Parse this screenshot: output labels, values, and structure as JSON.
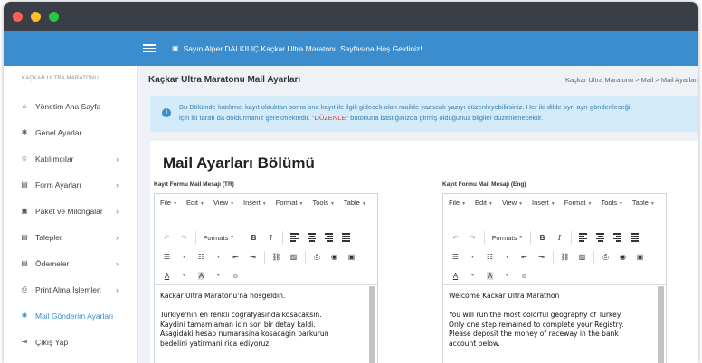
{
  "window": {
    "dots": [
      "#ff5f57",
      "#febc2e",
      "#28c840"
    ]
  },
  "topbar": {
    "welcome": "Sayın Alper DALKILIÇ Kaçkar Ultra Maratonu Sayfasına Hoş Geldiniz!",
    "accent": "#3c8dcd"
  },
  "sidebar": {
    "brand": "KAÇKAR ULTRA MARATONU",
    "items": [
      {
        "label": "Yönetim Ana Sayfa",
        "icon": "home-icon",
        "glyph": "⌂",
        "chevron": false,
        "active": false
      },
      {
        "label": "Genel Ayarlar",
        "icon": "gear-icon",
        "glyph": "✱",
        "chevron": false,
        "active": false
      },
      {
        "label": "Katılımcılar",
        "icon": "user-icon",
        "glyph": "☺",
        "chevron": true,
        "active": false
      },
      {
        "label": "Form Ayarları",
        "icon": "form-icon",
        "glyph": "▤",
        "chevron": true,
        "active": false
      },
      {
        "label": "Paket ve Milongalar",
        "icon": "package-icon",
        "glyph": "▣",
        "chevron": true,
        "active": false
      },
      {
        "label": "Talepler",
        "icon": "request-icon",
        "glyph": "▤",
        "chevron": true,
        "active": false
      },
      {
        "label": "Ödemeler",
        "icon": "payment-icon",
        "glyph": "▤",
        "chevron": true,
        "active": false
      },
      {
        "label": "Print Alma İşlemleri",
        "icon": "print-icon",
        "glyph": "⎙",
        "chevron": true,
        "active": false
      },
      {
        "label": "Mail Gönderim Ayarları",
        "icon": "mail-settings-icon",
        "glyph": "✱",
        "chevron": false,
        "active": true
      },
      {
        "label": "Çıkış Yap",
        "icon": "logout-icon",
        "glyph": "⇥",
        "chevron": false,
        "active": false
      }
    ]
  },
  "page": {
    "title": "Kaçkar Ultra Maratonu Mail Ayarları",
    "breadcrumb": "Kaçkar Ultra Maratonu  >  Mail  >  Mail Ayarları"
  },
  "alert": {
    "line1": "Bu Bölümde katılımcı kayıt olduktan sonra ona kayıt ile ilgili gidecek olan mailde yazacak yazıyı düzenleyebilirsiniz. Her iki dilde ayrı ayrı gönderileceği",
    "line2_pre": "için iki tarafı da doldurmanız gerekmektedir. ",
    "line2_hl": "\"DÜZENLE\"",
    "line2_post": " butonuna bastığınızda girmiş olduğunuz bilgiler düzenlenecektir."
  },
  "card": {
    "title": "Mail Ayarları Bölümü"
  },
  "editor_menus": [
    "File",
    "Edit",
    "View",
    "Insert",
    "Format",
    "Tools",
    "Table"
  ],
  "editor_formats_label": "Formats",
  "editors": [
    {
      "label": "Kayıt Formu Mail Mesajı (TR)",
      "text": "Kackar Ultra Maratonu'na hosgeldin.\n\nTürkiye'nin en renkli cografyasinda kosacaksin.\nKaydini tamamlaman icin son bir detay kaldi.\nAsagidaki hesap numarasina kosacagin parkurun\nbedelini yatirmani rica ediyoruz."
    },
    {
      "label": "Kayıt Formu Mail Mesajı (Eng)",
      "text": "Welcome Kackar Ultra Marathon\n\nYou will run the most colorful geography of Turkey.\nOnly one step remained to complete your Registry.\nPlease deposit the money of raceway in the bank\naccount below."
    }
  ]
}
